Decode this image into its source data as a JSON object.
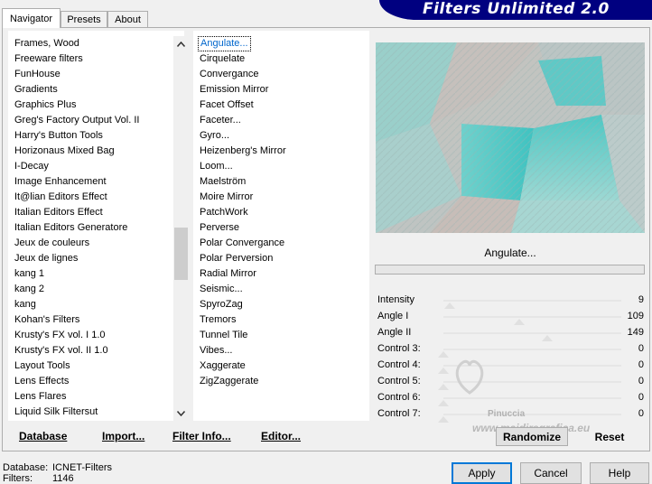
{
  "tabs": [
    {
      "label": "Navigator",
      "active": true
    },
    {
      "label": "Presets",
      "active": false
    },
    {
      "label": "About",
      "active": false
    }
  ],
  "banner": {
    "title": "Filters Unlimited 2.0",
    "color": "#000080"
  },
  "categories": {
    "items": [
      "Frames, Wood",
      "Freeware filters",
      "FunHouse",
      "Gradients",
      "Graphics Plus",
      "Greg's Factory Output Vol. II",
      "Harry's Button Tools",
      "Horizonaus Mixed Bag",
      "I-Decay",
      "Image Enhancement",
      "It@lian Editors Effect",
      "Italian Editors Effect",
      "Italian Editors Generatore",
      "Jeux de couleurs",
      "Jeux de lignes",
      "kang 1",
      "kang 2",
      "kang",
      "Kohan's Filters",
      "Krusty's FX vol. I 1.0",
      "Krusty's FX vol. II 1.0",
      "Layout Tools",
      "Lens Effects",
      "Lens Flares",
      "Liquid Silk Filtersut"
    ],
    "selected": "FunHouse"
  },
  "filters": {
    "items": [
      "Angulate...",
      "Cirquelate",
      "Convergance",
      "Emission Mirror",
      "Facet Offset",
      "Faceter...",
      "Gyro...",
      "Heizenberg's Mirror",
      "Loom...",
      "Maelström",
      "Moire Mirror",
      "PatchWork",
      "Perverse",
      "Polar Convergance",
      "Polar Perversion",
      "Radial Mirror",
      "Seismic...",
      "SpyroZag",
      "Tremors",
      "Tunnel Tile",
      "Vibes...",
      "Xaggerate",
      "ZigZaggerate"
    ],
    "selected": "Angulate..."
  },
  "left_buttons": {
    "database": "Database",
    "import": "Import...",
    "filter_info": "Filter Info...",
    "editor": "Editor..."
  },
  "preview": {
    "filter_name": "Angulate..."
  },
  "controls": [
    {
      "label": "Intensity",
      "value": "9",
      "level": 0.035
    },
    {
      "label": "Angle I",
      "value": "109",
      "level": 0.427
    },
    {
      "label": "Angle II",
      "value": "149",
      "level": 0.584
    },
    {
      "label": "Control 3:",
      "value": "0",
      "level": 0
    },
    {
      "label": "Control 4:",
      "value": "0",
      "level": 0
    },
    {
      "label": "Control 5:",
      "value": "0",
      "level": 0
    },
    {
      "label": "Control 6:",
      "value": "0",
      "level": 0
    },
    {
      "label": "Control 7:",
      "value": "0",
      "level": 0
    }
  ],
  "watermark": {
    "name": "Pinuccia",
    "url": "www.maidiregrafica.eu"
  },
  "right_buttons": {
    "randomize": "Randomize",
    "reset": "Reset"
  },
  "dialog_buttons": {
    "apply": "Apply",
    "cancel": "Cancel",
    "help": "Help"
  },
  "status": {
    "database_label": "Database:",
    "database_value": "ICNET-Filters",
    "filters_label": "Filters:",
    "filters_value": "1146"
  }
}
